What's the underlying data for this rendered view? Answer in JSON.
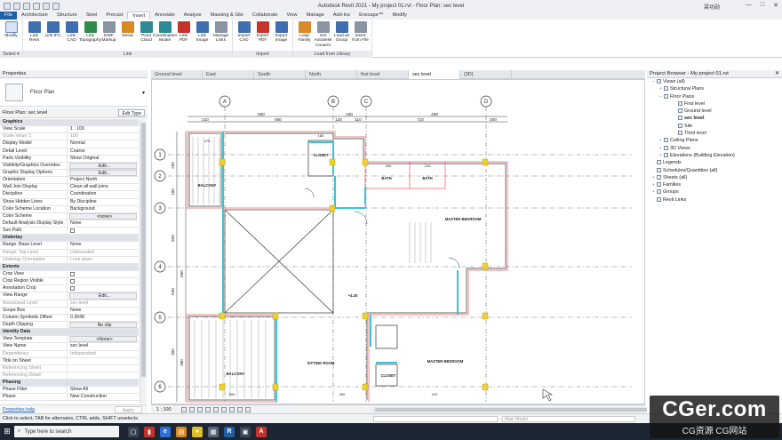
{
  "window": {
    "title": "Autodesk Revit 2021 - My project 01.rvt - Floor Plan: sec level",
    "user": "梁功勋",
    "controls": [
      "—",
      "□",
      "✕"
    ]
  },
  "ribbon_tabs": [
    "File",
    "Architecture",
    "Structure",
    "Steel",
    "Precast",
    "Insert",
    "Annotate",
    "Analyze",
    "Massing & Site",
    "Collaborate",
    "View",
    "Manage",
    "Add-Ins",
    "Enscape™",
    "Modify"
  ],
  "ribbon_active_tab": "Insert",
  "ribbon_groups": [
    {
      "label": "Select ▾",
      "buttons": [
        {
          "label": "Modify",
          "icon": "cursor-icon",
          "style": "modify"
        }
      ]
    },
    {
      "label": "Link",
      "buttons": [
        {
          "label": "Link Revit",
          "icon": "link-revit-icon",
          "style": "i-blue"
        },
        {
          "label": "Link IFC",
          "icon": "link-ifc-icon",
          "style": "i-blue"
        },
        {
          "label": "Link CAD",
          "icon": "link-cad-icon",
          "style": "i-blue"
        },
        {
          "label": "Link Topography",
          "icon": "link-topography-icon",
          "style": "i-green"
        },
        {
          "label": "DWF Markup",
          "icon": "dwf-markup-icon",
          "style": "i-gray"
        },
        {
          "label": "Decal",
          "icon": "decal-icon",
          "style": "i-orange"
        },
        {
          "label": "Point Cloud",
          "icon": "point-cloud-icon",
          "style": "i-teal"
        },
        {
          "label": "Coordination Model",
          "icon": "coordination-model-icon",
          "style": "i-teal"
        },
        {
          "label": "Link PDF",
          "icon": "link-pdf-icon",
          "style": "i-red"
        },
        {
          "label": "Link Image",
          "icon": "link-image-icon",
          "style": "i-blue"
        },
        {
          "label": "Manage Links",
          "icon": "manage-links-icon",
          "style": "i-gray"
        }
      ]
    },
    {
      "label": "Import",
      "buttons": [
        {
          "label": "Import CAD",
          "icon": "import-cad-icon",
          "style": "i-blue"
        },
        {
          "label": "Import PDF",
          "icon": "import-pdf-icon",
          "style": "i-red"
        },
        {
          "label": "Import Image",
          "icon": "import-image-icon",
          "style": "i-blue"
        }
      ]
    },
    {
      "label": "Load from Library",
      "buttons": [
        {
          "label": "Load Family",
          "icon": "load-family-icon",
          "style": "i-orange"
        },
        {
          "label": "Get Autodesk Content",
          "icon": "autodesk-content-icon",
          "style": "i-gray"
        },
        {
          "label": "Load as Group",
          "icon": "load-group-icon",
          "style": "i-blue"
        },
        {
          "label": "Insert from File",
          "icon": "insert-file-icon",
          "style": "i-gray"
        }
      ]
    }
  ],
  "properties": {
    "title": "Properties",
    "type_name": "Floor Plan",
    "instance_selector": "Floor Plan: sec level",
    "edit_type": "Edit Type",
    "rows": [
      {
        "section": "Graphics"
      },
      {
        "k": "View Scale",
        "v": "1 : 100"
      },
      {
        "k": "Scale Value    1:",
        "v": "100",
        "grey": true
      },
      {
        "k": "Display Model",
        "v": "Normal"
      },
      {
        "k": "Detail Level",
        "v": "Coarse"
      },
      {
        "k": "Parts Visibility",
        "v": "Show Original"
      },
      {
        "k": "Visibility/Graphics Overrides",
        "v": "Edit...",
        "btn": true
      },
      {
        "k": "Graphic Display Options",
        "v": "Edit...",
        "btn": true
      },
      {
        "k": "Orientation",
        "v": "Project North"
      },
      {
        "k": "Wall Join Display",
        "v": "Clean all wall joins"
      },
      {
        "k": "Discipline",
        "v": "Coordination"
      },
      {
        "k": "Show Hidden Lines",
        "v": "By Discipline"
      },
      {
        "k": "Color Scheme Location",
        "v": "Background"
      },
      {
        "k": "Color Scheme",
        "v": "<none>",
        "btn": true
      },
      {
        "k": "Default Analysis Display Style",
        "v": "None"
      },
      {
        "k": "Sun Path",
        "v": "",
        "chk": true
      },
      {
        "section": "Underlay"
      },
      {
        "k": "Range: Base Level",
        "v": "None"
      },
      {
        "k": "Range: Top Level",
        "v": "Unbounded",
        "grey": true
      },
      {
        "k": "Underlay Orientation",
        "v": "Look down",
        "grey": true
      },
      {
        "section": "Extents"
      },
      {
        "k": "Crop View",
        "v": "",
        "chk": true
      },
      {
        "k": "Crop Region Visible",
        "v": "",
        "chk": true
      },
      {
        "k": "Annotation Crop",
        "v": "",
        "chk": true
      },
      {
        "k": "View Range",
        "v": "Edit...",
        "btn": true
      },
      {
        "k": "Associated Level",
        "v": "sec level",
        "grey": true
      },
      {
        "k": "Scope Box",
        "v": "None"
      },
      {
        "k": "Column Symbolic Offset",
        "v": "0.3048"
      },
      {
        "k": "Depth Clipping",
        "v": "No clip",
        "btn": true
      },
      {
        "section": "Identity Data"
      },
      {
        "k": "View Template",
        "v": "<None>",
        "btn": true
      },
      {
        "k": "View Name",
        "v": "sec level"
      },
      {
        "k": "Dependency",
        "v": "Independent",
        "grey": true
      },
      {
        "k": "Title on Sheet",
        "v": ""
      },
      {
        "k": "Referencing Sheet",
        "v": "",
        "grey": true
      },
      {
        "k": "Referencing Detail",
        "v": "",
        "grey": true
      },
      {
        "section": "Phasing"
      },
      {
        "k": "Phase Filter",
        "v": "Show All"
      },
      {
        "k": "Phase",
        "v": "New Construction"
      }
    ],
    "help": "Properties help",
    "apply": "Apply"
  },
  "view_tabs": [
    "Ground level",
    "East",
    "South",
    "North",
    "first level",
    "sec level",
    "{3D}"
  ],
  "view_tab_active": "sec level",
  "drawing": {
    "grid_top": [
      "A",
      "B",
      "C",
      "D"
    ],
    "grid_left": [
      "1",
      "2",
      "3",
      "4",
      "5",
      "6"
    ],
    "dims_top_1": [
      "560",
      "150",
      "430"
    ],
    "dims_top_2": [
      "210",
      "650",
      "120",
      "110",
      "710",
      "200"
    ],
    "dims_left": [
      "200",
      "180",
      "600",
      "540",
      "300",
      "650",
      "380"
    ],
    "rooms": [
      "BALCONY",
      "CLOSET",
      "BATH",
      "BATH",
      "MASTER BEDROOM",
      "SITTING ROOM",
      "BALCONY",
      "MASTER BEDROOM",
      "CLOSET"
    ],
    "level_tag": "+4.20",
    "dims_inner": [
      "470",
      "180",
      "300",
      "120",
      "500",
      "300",
      "470"
    ]
  },
  "view_scale": "1 : 100",
  "project_browser": {
    "title": "Project Browser - My project 01.rvt",
    "nodes": [
      {
        "label": "Views (all)",
        "d": 0,
        "tog": "−"
      },
      {
        "label": "Structural Plans",
        "d": 1,
        "tog": "+"
      },
      {
        "label": "Floor Plans",
        "d": 1,
        "tog": "−"
      },
      {
        "label": "First level",
        "d": 3,
        "tog": ""
      },
      {
        "label": "Ground level",
        "d": 3,
        "tog": ""
      },
      {
        "label": "sec level",
        "d": 3,
        "tog": "",
        "sel": true
      },
      {
        "label": "Site",
        "d": 3,
        "tog": ""
      },
      {
        "label": "Third level",
        "d": 3,
        "tog": ""
      },
      {
        "label": "Ceiling Plans",
        "d": 1,
        "tog": "+"
      },
      {
        "label": "3D Views",
        "d": 1,
        "tog": "+"
      },
      {
        "label": "Elevations (Building Elevation)",
        "d": 1,
        "tog": "+"
      },
      {
        "label": "Legends",
        "d": 0,
        "tog": ""
      },
      {
        "label": "Schedules/Quantities (all)",
        "d": 0,
        "tog": ""
      },
      {
        "label": "Sheets (all)",
        "d": 0,
        "tog": "+"
      },
      {
        "label": "Families",
        "d": 0,
        "tog": "+"
      },
      {
        "label": "Groups",
        "d": 0,
        "tog": "+"
      },
      {
        "label": "Revit Links",
        "d": 0,
        "tog": ""
      }
    ]
  },
  "status": {
    "message": "Click to select, TAB for alternates, CTRL adds, SHIFT unselects.",
    "model": "Main Model",
    "zero": ":0"
  },
  "taskbar": {
    "search_placeholder": "Type here to search"
  },
  "watermark": {
    "big": "CGer.com",
    "small": "CG资源  CG网站"
  }
}
